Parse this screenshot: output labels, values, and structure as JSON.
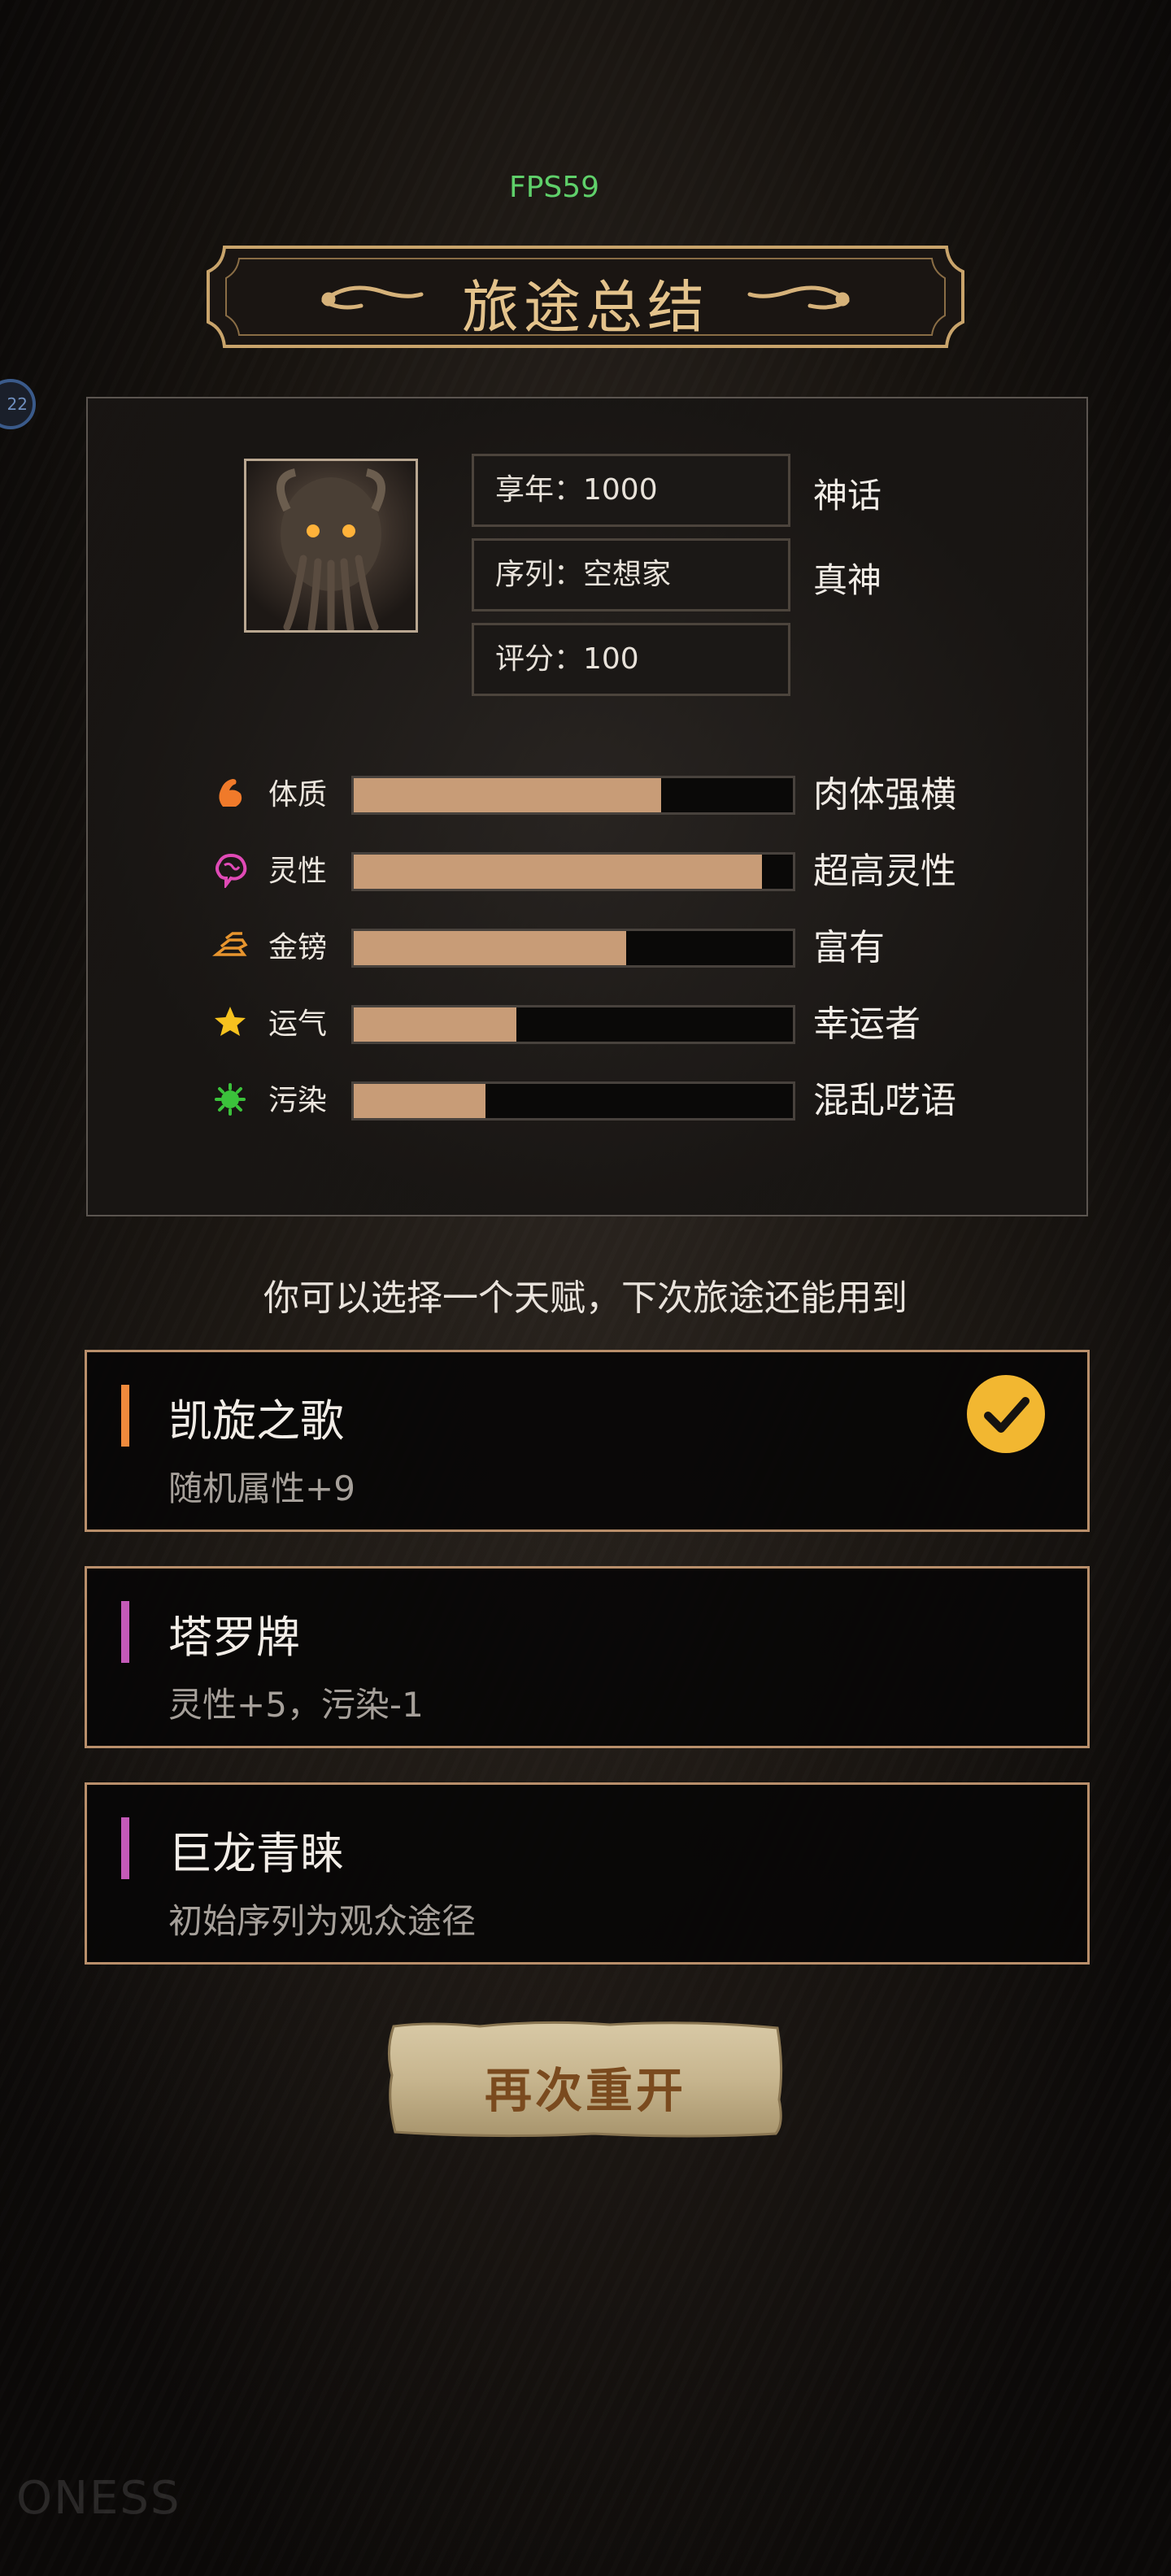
{
  "hud": {
    "fps": "FPS59",
    "side_badge": "22"
  },
  "banner": {
    "title": "旅途总结"
  },
  "summary": {
    "info": [
      {
        "label": "享年：1000",
        "tag": "神话"
      },
      {
        "label": "序列：空想家",
        "tag": "真神"
      },
      {
        "label": "评分：100",
        "tag": ""
      }
    ],
    "stats": [
      {
        "icon": "muscle-icon",
        "label": "体质",
        "fill": 0.7,
        "tag": "肉体强横",
        "color": "#f07a2a"
      },
      {
        "icon": "brain-icon",
        "label": "灵性",
        "fill": 0.93,
        "tag": "超高灵性",
        "color": "#e04ab6"
      },
      {
        "icon": "gold-bars-icon",
        "label": "金镑",
        "fill": 0.62,
        "tag": "富有",
        "color": "#e8952e"
      },
      {
        "icon": "star-icon",
        "label": "运气",
        "fill": 0.37,
        "tag": "幸运者",
        "color": "#f6c21f"
      },
      {
        "icon": "virus-icon",
        "label": "污染",
        "fill": 0.3,
        "tag": "混乱呓语",
        "color": "#3bc23b"
      }
    ]
  },
  "prompt": "你可以选择一个天赋，下次旅途还能用到",
  "talents": [
    {
      "title": "凯旋之歌",
      "desc": "随机属性+9",
      "accent": "#f08a3c",
      "selected": true
    },
    {
      "title": "塔罗牌",
      "desc": "灵性+5，污染-1",
      "accent": "#c45ab8",
      "selected": false
    },
    {
      "title": "巨龙青睐",
      "desc": "初始序列为观众途径",
      "accent": "#c45ab8",
      "selected": false
    }
  ],
  "restart_button": "再次重开",
  "watermark": "ONESS"
}
